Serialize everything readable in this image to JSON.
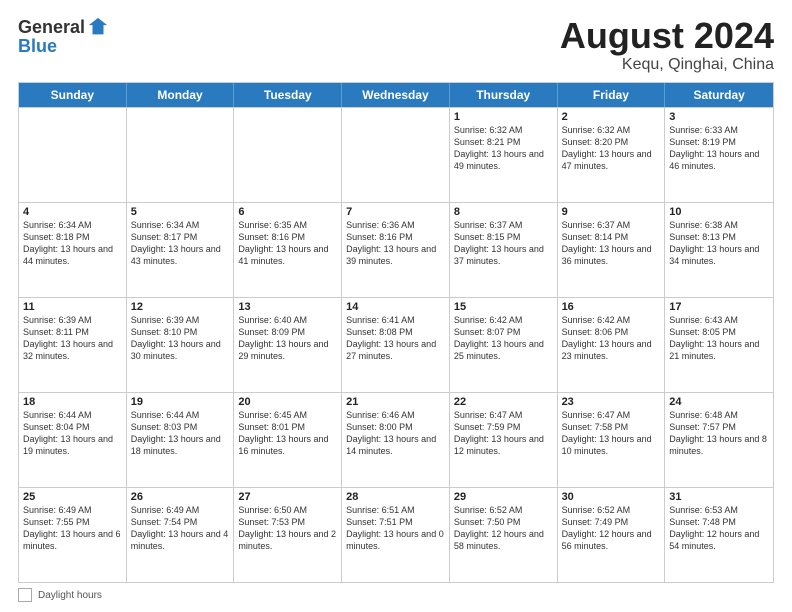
{
  "header": {
    "logo_line1": "General",
    "logo_line2": "Blue",
    "title": "August 2024",
    "subtitle": "Kequ, Qinghai, China"
  },
  "days": [
    "Sunday",
    "Monday",
    "Tuesday",
    "Wednesday",
    "Thursday",
    "Friday",
    "Saturday"
  ],
  "footer_label": "Daylight hours",
  "weeks": [
    [
      {
        "date": "",
        "info": ""
      },
      {
        "date": "",
        "info": ""
      },
      {
        "date": "",
        "info": ""
      },
      {
        "date": "",
        "info": ""
      },
      {
        "date": "1",
        "info": "Sunrise: 6:32 AM\nSunset: 8:21 PM\nDaylight: 13 hours and 49 minutes."
      },
      {
        "date": "2",
        "info": "Sunrise: 6:32 AM\nSunset: 8:20 PM\nDaylight: 13 hours and 47 minutes."
      },
      {
        "date": "3",
        "info": "Sunrise: 6:33 AM\nSunset: 8:19 PM\nDaylight: 13 hours and 46 minutes."
      }
    ],
    [
      {
        "date": "4",
        "info": "Sunrise: 6:34 AM\nSunset: 8:18 PM\nDaylight: 13 hours and 44 minutes."
      },
      {
        "date": "5",
        "info": "Sunrise: 6:34 AM\nSunset: 8:17 PM\nDaylight: 13 hours and 43 minutes."
      },
      {
        "date": "6",
        "info": "Sunrise: 6:35 AM\nSunset: 8:16 PM\nDaylight: 13 hours and 41 minutes."
      },
      {
        "date": "7",
        "info": "Sunrise: 6:36 AM\nSunset: 8:16 PM\nDaylight: 13 hours and 39 minutes."
      },
      {
        "date": "8",
        "info": "Sunrise: 6:37 AM\nSunset: 8:15 PM\nDaylight: 13 hours and 37 minutes."
      },
      {
        "date": "9",
        "info": "Sunrise: 6:37 AM\nSunset: 8:14 PM\nDaylight: 13 hours and 36 minutes."
      },
      {
        "date": "10",
        "info": "Sunrise: 6:38 AM\nSunset: 8:13 PM\nDaylight: 13 hours and 34 minutes."
      }
    ],
    [
      {
        "date": "11",
        "info": "Sunrise: 6:39 AM\nSunset: 8:11 PM\nDaylight: 13 hours and 32 minutes."
      },
      {
        "date": "12",
        "info": "Sunrise: 6:39 AM\nSunset: 8:10 PM\nDaylight: 13 hours and 30 minutes."
      },
      {
        "date": "13",
        "info": "Sunrise: 6:40 AM\nSunset: 8:09 PM\nDaylight: 13 hours and 29 minutes."
      },
      {
        "date": "14",
        "info": "Sunrise: 6:41 AM\nSunset: 8:08 PM\nDaylight: 13 hours and 27 minutes."
      },
      {
        "date": "15",
        "info": "Sunrise: 6:42 AM\nSunset: 8:07 PM\nDaylight: 13 hours and 25 minutes."
      },
      {
        "date": "16",
        "info": "Sunrise: 6:42 AM\nSunset: 8:06 PM\nDaylight: 13 hours and 23 minutes."
      },
      {
        "date": "17",
        "info": "Sunrise: 6:43 AM\nSunset: 8:05 PM\nDaylight: 13 hours and 21 minutes."
      }
    ],
    [
      {
        "date": "18",
        "info": "Sunrise: 6:44 AM\nSunset: 8:04 PM\nDaylight: 13 hours and 19 minutes."
      },
      {
        "date": "19",
        "info": "Sunrise: 6:44 AM\nSunset: 8:03 PM\nDaylight: 13 hours and 18 minutes."
      },
      {
        "date": "20",
        "info": "Sunrise: 6:45 AM\nSunset: 8:01 PM\nDaylight: 13 hours and 16 minutes."
      },
      {
        "date": "21",
        "info": "Sunrise: 6:46 AM\nSunset: 8:00 PM\nDaylight: 13 hours and 14 minutes."
      },
      {
        "date": "22",
        "info": "Sunrise: 6:47 AM\nSunset: 7:59 PM\nDaylight: 13 hours and 12 minutes."
      },
      {
        "date": "23",
        "info": "Sunrise: 6:47 AM\nSunset: 7:58 PM\nDaylight: 13 hours and 10 minutes."
      },
      {
        "date": "24",
        "info": "Sunrise: 6:48 AM\nSunset: 7:57 PM\nDaylight: 13 hours and 8 minutes."
      }
    ],
    [
      {
        "date": "25",
        "info": "Sunrise: 6:49 AM\nSunset: 7:55 PM\nDaylight: 13 hours and 6 minutes."
      },
      {
        "date": "26",
        "info": "Sunrise: 6:49 AM\nSunset: 7:54 PM\nDaylight: 13 hours and 4 minutes."
      },
      {
        "date": "27",
        "info": "Sunrise: 6:50 AM\nSunset: 7:53 PM\nDaylight: 13 hours and 2 minutes."
      },
      {
        "date": "28",
        "info": "Sunrise: 6:51 AM\nSunset: 7:51 PM\nDaylight: 13 hours and 0 minutes."
      },
      {
        "date": "29",
        "info": "Sunrise: 6:52 AM\nSunset: 7:50 PM\nDaylight: 12 hours and 58 minutes."
      },
      {
        "date": "30",
        "info": "Sunrise: 6:52 AM\nSunset: 7:49 PM\nDaylight: 12 hours and 56 minutes."
      },
      {
        "date": "31",
        "info": "Sunrise: 6:53 AM\nSunset: 7:48 PM\nDaylight: 12 hours and 54 minutes."
      }
    ]
  ]
}
